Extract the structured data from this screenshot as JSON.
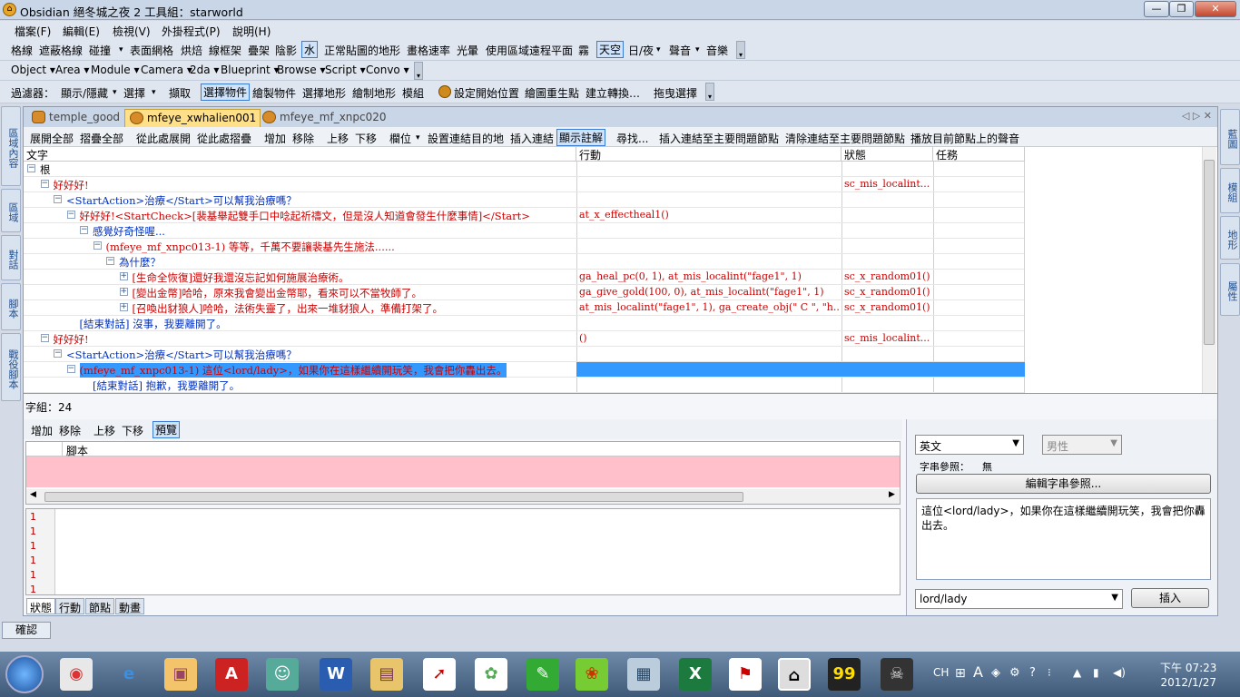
{
  "window": {
    "title": "Obsidian 絕冬城之夜 2 工具組：starworld",
    "minimize": "—",
    "maximize": "❐",
    "close": "✕"
  },
  "menubar": [
    "檔案(F)",
    "編輯(E)",
    "檢視(V)",
    "外掛程式(P)",
    "說明(H)"
  ],
  "toolbar1": [
    "格線",
    "遮蔽格線",
    "碰撞",
    "▾",
    "表面網格",
    "烘焙",
    "線框架",
    "疊架",
    "陰影",
    "水",
    "正常貼圖的地形",
    "畫格速率",
    "光暈",
    "使用區域遠程平面",
    "霧",
    "天空",
    "日/夜",
    "▾",
    "聲音",
    "▾",
    "音樂"
  ],
  "toolbar2": [
    "Object ▾",
    "Area ▾",
    "Module ▾",
    "Camera ▾",
    "2da ▾",
    "Blueprint ▾",
    "Browse ▾",
    "Script ▾",
    "Convo ▾"
  ],
  "toolbar3": [
    "過濾器：",
    "顯示/隱藏",
    "▾",
    "選擇",
    "▾",
    "擷取",
    "選擇物件",
    "繪製物件",
    "選擇地形",
    "繪制地形",
    "模組",
    "設定開始位置",
    "繪圖重生點",
    "建立轉換…",
    "拖曳選擇"
  ],
  "left_tabs": [
    "區域內容",
    "區域",
    "對話",
    "腳本",
    "戰役腳本"
  ],
  "right_tabs": [
    "藍圖",
    "模組",
    "地形",
    "屬性"
  ],
  "doc_tabs": [
    {
      "label": "temple_good",
      "active": false
    },
    {
      "label": "mfeye_xwhalien001",
      "active": true
    },
    {
      "label": "mfeye_mf_xnpc020",
      "active": false
    }
  ],
  "tab_nav": "◁ ▷ ✕",
  "dialog_toolbar": [
    "展開全部",
    "摺疊全部",
    "從此處展開",
    "從此處摺疊",
    "增加",
    "移除",
    "上移",
    "下移",
    "欄位",
    "▾",
    "設置連結目的地",
    "插入連結",
    "顯示註解",
    "尋找...",
    "插入連結至主要問題節點",
    "清除連結至主要問題節點",
    "播放目前節點上的聲音"
  ],
  "grid": {
    "columns": [
      "文字",
      "行動",
      "狀態",
      "任務"
    ],
    "rows": [
      {
        "indent": 0,
        "expander": "⊟",
        "text": "根",
        "color": "black",
        "action": "",
        "condition": "",
        "quest": ""
      },
      {
        "indent": 1,
        "expander": "⊟",
        "text": "好好好!",
        "color": "red",
        "action": "",
        "condition": "sc_mis_localint...",
        "quest": ""
      },
      {
        "indent": 2,
        "expander": "⊟",
        "text": "<StartAction>治療</Start>可以幫我治療嗎？",
        "color": "blue",
        "action": "",
        "condition": "",
        "quest": ""
      },
      {
        "indent": 3,
        "expander": "⊟",
        "text": "好好好!<StartCheck>[裴基舉起雙手口中唸起祈禱文，但是沒人知道會發生什麼事情]</Start>",
        "color": "red",
        "action": "at_x_effectheal1()",
        "condition": "",
        "quest": ""
      },
      {
        "indent": 4,
        "expander": "⊟",
        "text": "感覺好奇怪喔...",
        "color": "blue",
        "action": "",
        "condition": "",
        "quest": ""
      },
      {
        "indent": 5,
        "expander": "⊟",
        "text": "(mfeye_mf_xnpc013-1) 等等，千萬不要讓裴基先生施法......",
        "color": "red",
        "action": "",
        "condition": "",
        "quest": ""
      },
      {
        "indent": 6,
        "expander": "⊟",
        "text": "為什麼？",
        "color": "blue",
        "action": "",
        "condition": "",
        "quest": ""
      },
      {
        "indent": 7,
        "expander": "⊞",
        "text": "[生命全恢復]還好我還沒忘記如何施展治療術。",
        "color": "red",
        "action": "ga_heal_pc(0, 1), at_mis_localint(\"fage1\", 1)",
        "condition": "sc_x_random01()",
        "quest": ""
      },
      {
        "indent": 7,
        "expander": "⊞",
        "text": "[變出金幣]哈哈，原來我會變出金幣耶，看來可以不當牧師了。",
        "color": "red",
        "action": "ga_give_gold(100, 0), at_mis_localint(\"fage1\", 1)",
        "condition": "sc_x_random01()",
        "quest": ""
      },
      {
        "indent": 7,
        "expander": "⊞",
        "text": "[召喚出豺狼人]哈哈，法術失靈了，出來一堆豺狼人，準備打架了。",
        "color": "red",
        "action": "at_mis_localint(\"fage1\",  1),  ga_create_obj(\" C \",  \"h...",
        "condition": "sc_x_random01()",
        "quest": ""
      },
      {
        "indent": 3,
        "expander": "",
        "text": "[結束對話] 沒事，我要離開了。",
        "color": "blue",
        "action": "",
        "condition": "",
        "quest": ""
      },
      {
        "indent": 1,
        "expander": "⊟",
        "text": "好好好!",
        "color": "red",
        "action": "()",
        "condition": "sc_mis_localint...",
        "quest": ""
      },
      {
        "indent": 2,
        "expander": "⊟",
        "text": "<StartAction>治療</Start>可以幫我治療嗎？",
        "color": "blue",
        "action": "",
        "condition": "",
        "quest": ""
      },
      {
        "indent": 3,
        "expander": "⊟",
        "text": "(mfeye_mf_xnpc013-1) 這位<lord/lady>，如果你在這樣繼續開玩笑，我會把你轟出去。",
        "color": "red",
        "action": "",
        "condition": "",
        "quest": "",
        "selected": true
      },
      {
        "indent": 4,
        "expander": "",
        "text": "[結束對話] 抱歉，我要離開了。",
        "color": "blue",
        "action": "",
        "condition": "",
        "quest": ""
      }
    ]
  },
  "char_count": "字組：24",
  "script_toolbar": [
    "增加",
    "移除",
    "上移",
    "下移",
    "預覽"
  ],
  "script_grid_header": "腳本",
  "code_lines": [
    "1",
    "1",
    "1",
    "1",
    "1",
    "1"
  ],
  "bottom_tabs": [
    "狀態",
    "行動",
    "節點",
    "動畫"
  ],
  "right_panel": {
    "language": "英文",
    "gender": "男性",
    "string_ref_label": "字串參照：",
    "string_ref_value": "無",
    "edit_button": "編輯字串參照...",
    "text": "這位<lord/lady>，如果你在這樣繼續開玩笑，我會把你轟出去。",
    "token": "lord/lady",
    "insert_button": "插入"
  },
  "status": {
    "confirm": "確認"
  },
  "taskbar": {
    "icons": [
      "chrome",
      "ie",
      "paint",
      "autocad",
      "messenger",
      "word",
      "explorer",
      "acrobat-r",
      "picasa",
      "evernote",
      "parrot",
      "tool",
      "excel",
      "pdf",
      "obsidian",
      "counter",
      "nwn"
    ],
    "lang": "CH",
    "clock_time": "下午 07:23",
    "clock_date": "2012/1/27"
  }
}
